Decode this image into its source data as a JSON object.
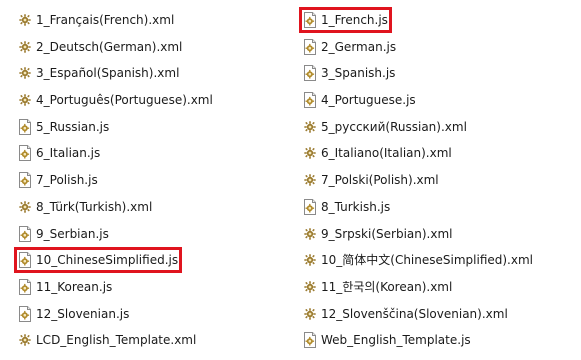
{
  "left_column": [
    {
      "name": "1_Français(French).xml",
      "type": "xml"
    },
    {
      "name": "2_Deutsch(German).xml",
      "type": "xml"
    },
    {
      "name": "3_Español(Spanish).xml",
      "type": "xml"
    },
    {
      "name": "4_Português(Portuguese).xml",
      "type": "xml"
    },
    {
      "name": "5_Russian.js",
      "type": "js"
    },
    {
      "name": "6_Italian.js",
      "type": "js"
    },
    {
      "name": "7_Polish.js",
      "type": "js"
    },
    {
      "name": "8_Türk(Turkish).xml",
      "type": "xml"
    },
    {
      "name": "9_Serbian.js",
      "type": "js"
    },
    {
      "name": "10_ChineseSimplified.js",
      "type": "js",
      "highlighted": true
    },
    {
      "name": "11_Korean.js",
      "type": "js"
    },
    {
      "name": "12_Slovenian.js",
      "type": "js"
    },
    {
      "name": "LCD_English_Template.xml",
      "type": "xml"
    }
  ],
  "right_column": [
    {
      "name": "1_French.js",
      "type": "js",
      "highlighted": true
    },
    {
      "name": "2_German.js",
      "type": "js"
    },
    {
      "name": "3_Spanish.js",
      "type": "js"
    },
    {
      "name": "4_Portuguese.js",
      "type": "js"
    },
    {
      "name": "5_русский(Russian).xml",
      "type": "xml"
    },
    {
      "name": "6_Italiano(Italian).xml",
      "type": "xml"
    },
    {
      "name": "7_Polski(Polish).xml",
      "type": "xml"
    },
    {
      "name": "8_Turkish.js",
      "type": "js"
    },
    {
      "name": "9_Srpski(Serbian).xml",
      "type": "xml"
    },
    {
      "name": "10_简体中文(ChineseSimplified).xml",
      "type": "xml"
    },
    {
      "name": "11_한국의(Korean).xml",
      "type": "xml"
    },
    {
      "name": "12_Slovenščina(Slovenian).xml",
      "type": "xml"
    },
    {
      "name": "Web_English_Template.js",
      "type": "js"
    }
  ],
  "icons": {
    "xml": "xml-file-icon",
    "js": "js-file-icon"
  },
  "colors": {
    "highlight": "#e0141e",
    "text": "#1a1a1a",
    "background": "#ffffff"
  }
}
